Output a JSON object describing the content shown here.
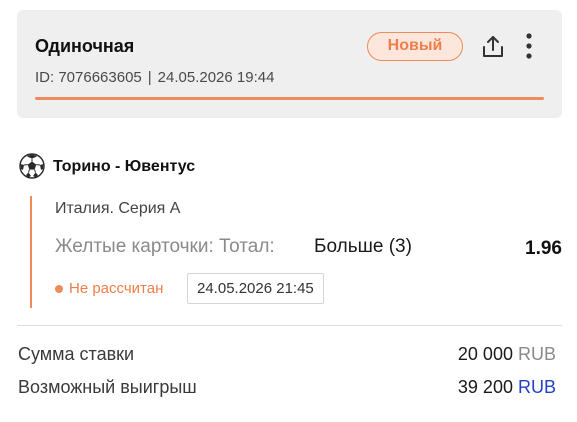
{
  "header": {
    "bet_type": "Одиночная",
    "status": "Новый",
    "bet_id": "ID: 7076663605",
    "separator": "|",
    "placed_at": "24.05.2026 19:44"
  },
  "event": {
    "title": "Торино - Ювентус",
    "sport_icon": "soccer-ball-icon"
  },
  "selection": {
    "league": "Италия. Серия А",
    "market": "Желтые карточки: Тотал:",
    "outcome": "Больше (3)",
    "odds": "1.96",
    "settle_status": "Не рассчитан",
    "event_time": "24.05.2026 21:45"
  },
  "summary": {
    "stake_label": "Сумма ставки",
    "stake_amount": "20 000",
    "stake_currency": "RUB",
    "payout_label": "Возможный выигрыш",
    "payout_amount": "39 200",
    "payout_currency": "RUB"
  },
  "colors": {
    "accent": "#ef8b5a",
    "status_bg": "#fde7dc",
    "card_bg": "#efefef",
    "currency_link": "#2340c9"
  }
}
